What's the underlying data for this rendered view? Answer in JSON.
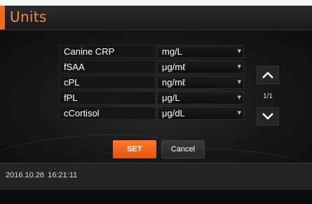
{
  "title": "Units",
  "rows": [
    {
      "label": "Canine CRP",
      "unit": "mg/L"
    },
    {
      "label": "fSAA",
      "unit": "μg/mℓ"
    },
    {
      "label": "cPL",
      "unit": "ng/mℓ"
    },
    {
      "label": "fPL",
      "unit": "μg/L"
    },
    {
      "label": "cCortisol",
      "unit": "μg/dL"
    }
  ],
  "pager": {
    "page": "1/1"
  },
  "buttons": {
    "set": "SET",
    "cancel": "Cancel"
  },
  "status": {
    "date": "2016.10.26",
    "time": "16:21:11"
  },
  "colors": {
    "accent": "#f36a1c",
    "title_text": "#f58a3c",
    "background": "#151515"
  },
  "icons": {
    "up": "chevron-up-icon",
    "down": "chevron-down-icon",
    "dropdown": "dropdown-arrow-icon"
  }
}
